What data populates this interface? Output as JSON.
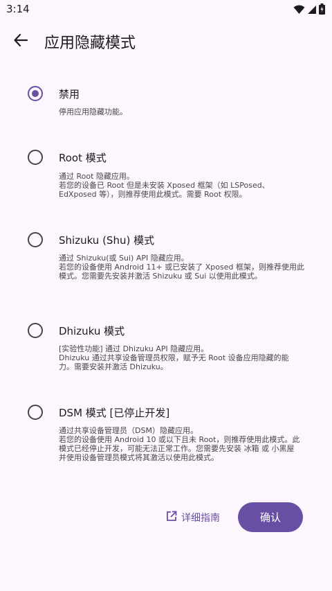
{
  "status_bar": {
    "time": "3:14",
    "icons": [
      "wifi-icon",
      "signal-icon",
      "battery-icon"
    ]
  },
  "app_bar": {
    "back_icon": "arrow-back-icon",
    "title": "应用隐藏模式"
  },
  "options": [
    {
      "title": "禁用",
      "description": "停用应用隐藏功能。",
      "selected": true
    },
    {
      "title": "Root 模式",
      "description": "通过 Root 隐藏应用。\n若您的设备已 Root 但是未安装 Xposed 框架（如 LSPosed、\nEdXposed 等），则推荐使用此模式。需要 Root 权限。",
      "selected": false
    },
    {
      "title": "Shizuku (Shu) 模式",
      "description": "通过 Shizuku(或 Sui) API 隐藏应用。\n若您的设备使用 Android 11+ 或已安装了 Xposed 框架，则推荐使用此\n模式。您需要先安装并激活 Shizuku 或 Sui 以使用此模式。",
      "selected": false
    },
    {
      "title": "Dhizuku 模式",
      "description": "[实验性功能] 通过 Dhizuku API 隐藏应用。\nDhizuku 通过共享设备管理员权限，赋予无 Root 设备应用隐藏的能\n力。需要安装并激活 Dhizuku。",
      "selected": false
    },
    {
      "title": "DSM 模式 [已停止开发]",
      "description": "通过共享设备管理员（DSM）隐藏应用。\n若您的设备使用 Android 10 或以下且未 Root，则推荐使用此模式。此\n模式已经停止开发，可能无法正常工作。您需要先安装 冰箱 或 小黑屋\n并使用设备管理员模式将其激活以使用此模式。",
      "selected": false
    }
  ],
  "actions": {
    "guide_icon": "open-in-new-icon",
    "guide_label": "详细指南",
    "confirm_label": "确认"
  },
  "colors": {
    "background": "#fdf7fd",
    "accent": "#6750a4",
    "text_primary": "#1c1b1f",
    "text_secondary": "#49454f"
  }
}
